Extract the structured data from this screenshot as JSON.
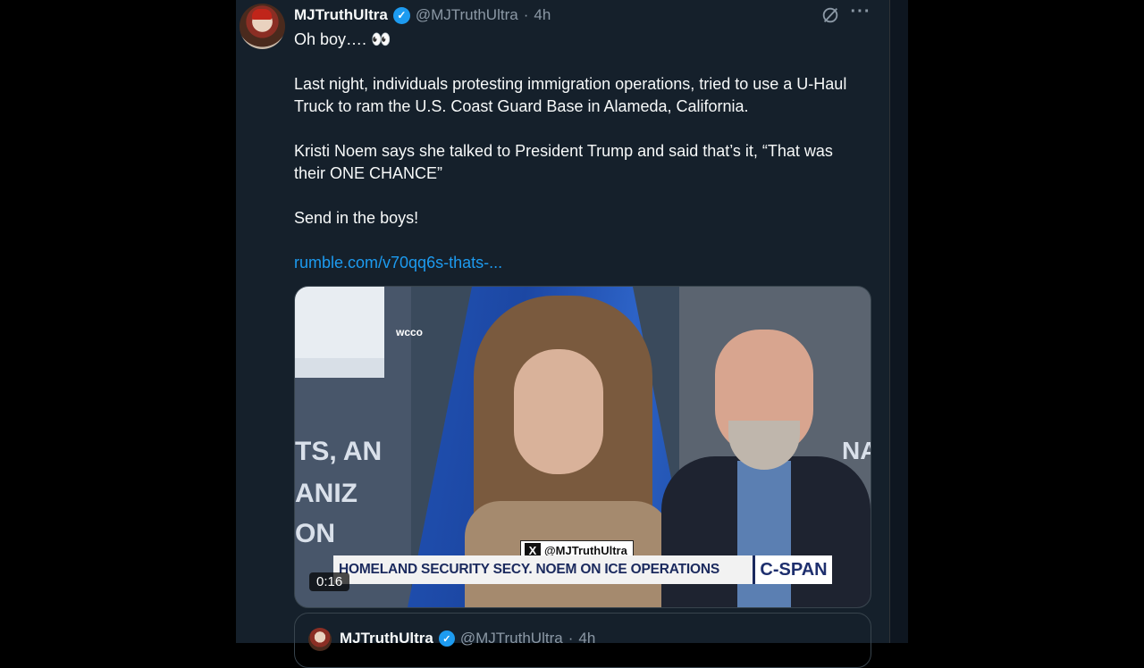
{
  "tweet": {
    "author_name": "MJTruthUltra",
    "author_handle": "@MJTruthUltra",
    "separator": "·",
    "time": "4h",
    "verified_mark": "✓",
    "more_icon": "···",
    "paragraphs": [
      "Oh boy…. 👀",
      "Last night, individuals protesting immigration operations, tried to use a U-Haul Truck to ram the U.S. Coast Guard Base in Alameda, California.",
      "Kristi Noem says she talked to President Trump and said that’s it, “That was their ONE CHANCE”",
      "Send in the boys!"
    ],
    "link": "rumble.com/v70qq6s-thats-..."
  },
  "media": {
    "station_tag": "wcco",
    "bg_text_1": "TS, AN",
    "bg_text_2": "ANIZ",
    "bg_text_3": "ON",
    "bg_text_right": "NAL",
    "watermark_x": "X",
    "watermark_handle": "@MJTruthUltra",
    "chyron": "HOMELAND SECURITY SECY. NOEM ON ICE OPERATIONS",
    "network": "C-SPAN",
    "duration": "0:16"
  },
  "quoted": {
    "author_name": "MJTruthUltra",
    "author_handle": "@MJTruthUltra",
    "separator": "·",
    "time": "4h",
    "verified_mark": "✓"
  },
  "colors": {
    "background": "#15202b",
    "accent": "#1d9bf0",
    "text": "#f7f9f9",
    "muted": "#8b98a5"
  }
}
